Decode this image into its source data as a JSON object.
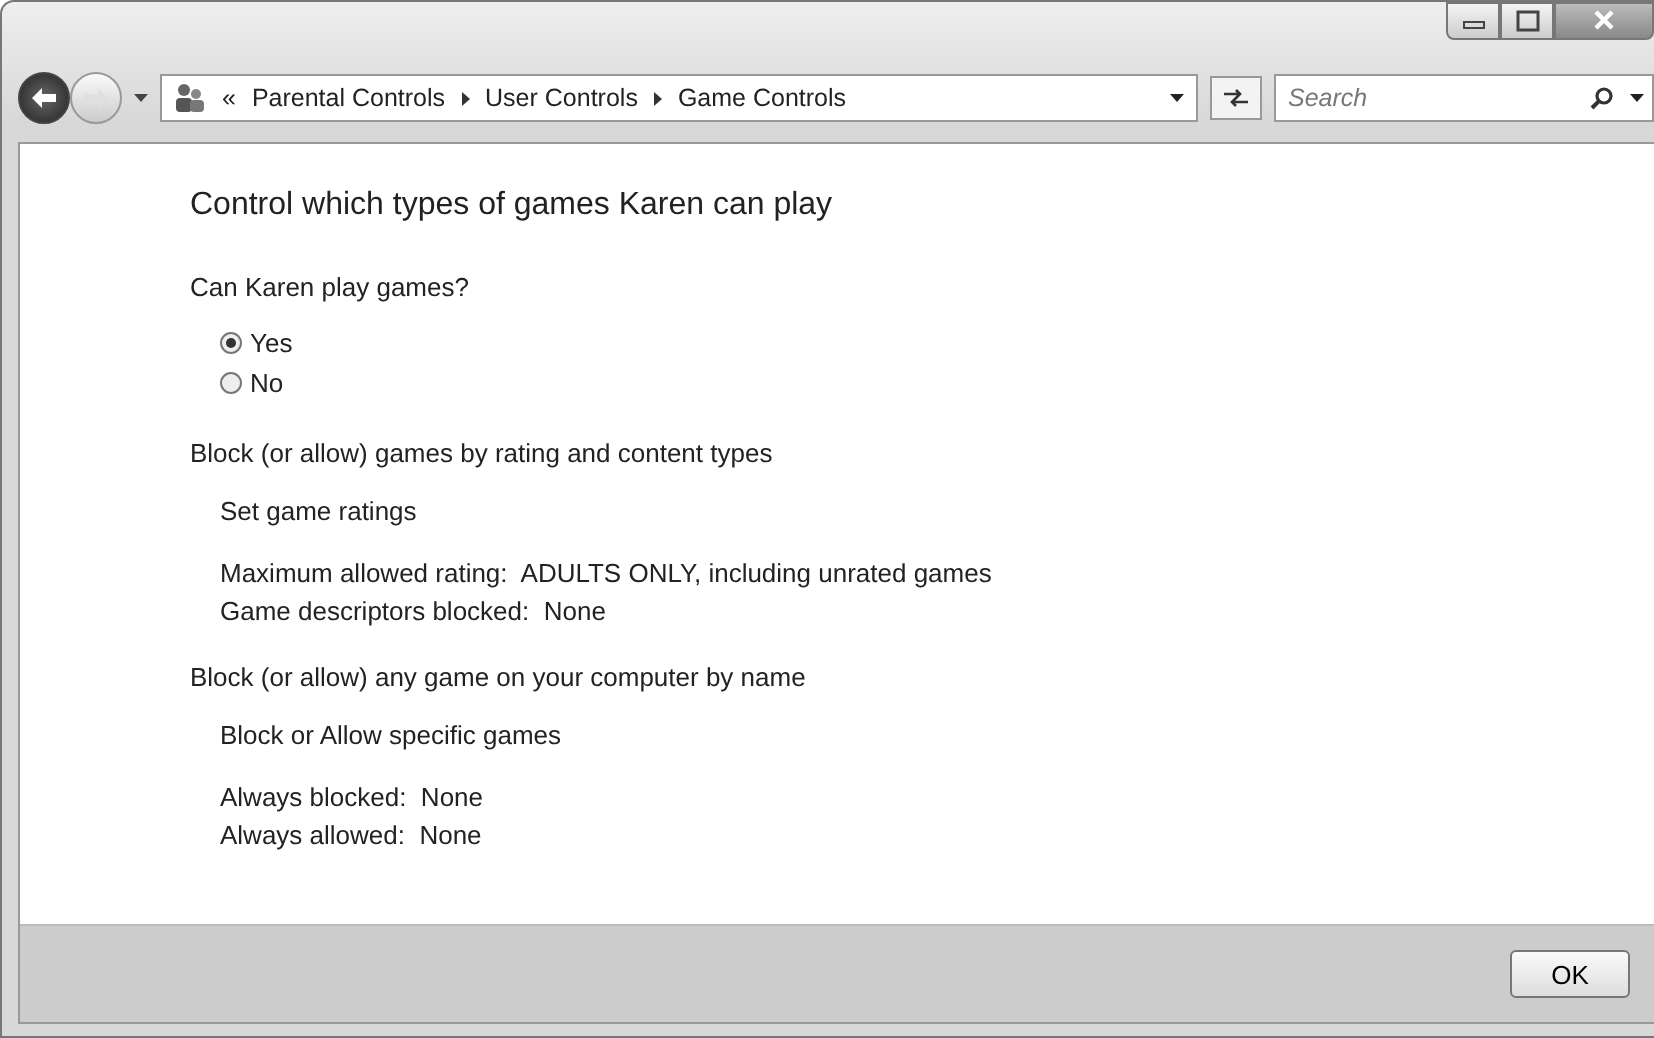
{
  "address_bar": {
    "overflow": "«",
    "crumbs": [
      "Parental Controls",
      "User Controls",
      "Game Controls"
    ]
  },
  "search": {
    "placeholder": "Search"
  },
  "title": "Control which types of games Karen can play",
  "question": {
    "label": "Can Karen play games?",
    "options": [
      {
        "label": "Yes",
        "selected": true
      },
      {
        "label": "No",
        "selected": false
      }
    ]
  },
  "sections": [
    {
      "heading": "Block (or allow) games by rating and content types",
      "link": "Set game ratings",
      "details": [
        "Maximum allowed rating:  ADULTS ONLY, including unrated games",
        "Game descriptors blocked:  None"
      ]
    },
    {
      "heading": "Block (or allow) any game on your computer by name",
      "link": "Block or Allow specific games",
      "details": [
        "Always blocked:  None",
        "Always allowed:  None"
      ]
    }
  ],
  "footer": {
    "buttons": [
      "OK"
    ]
  }
}
